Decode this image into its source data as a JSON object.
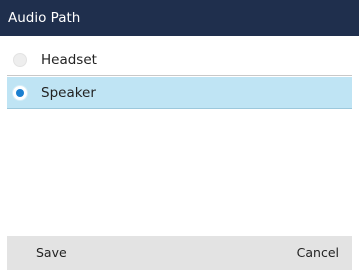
{
  "title": "Audio Path",
  "options": [
    {
      "label": "Headset",
      "selected": false
    },
    {
      "label": "Speaker",
      "selected": true
    }
  ],
  "softkeys": {
    "save": "Save",
    "cancel": "Cancel"
  },
  "colors": {
    "title_bar": "#1f2f4d",
    "selected_row": "#bfe4f4",
    "radio_selected": "#1a7fd0",
    "softkey_bar": "#e3e3e3"
  }
}
